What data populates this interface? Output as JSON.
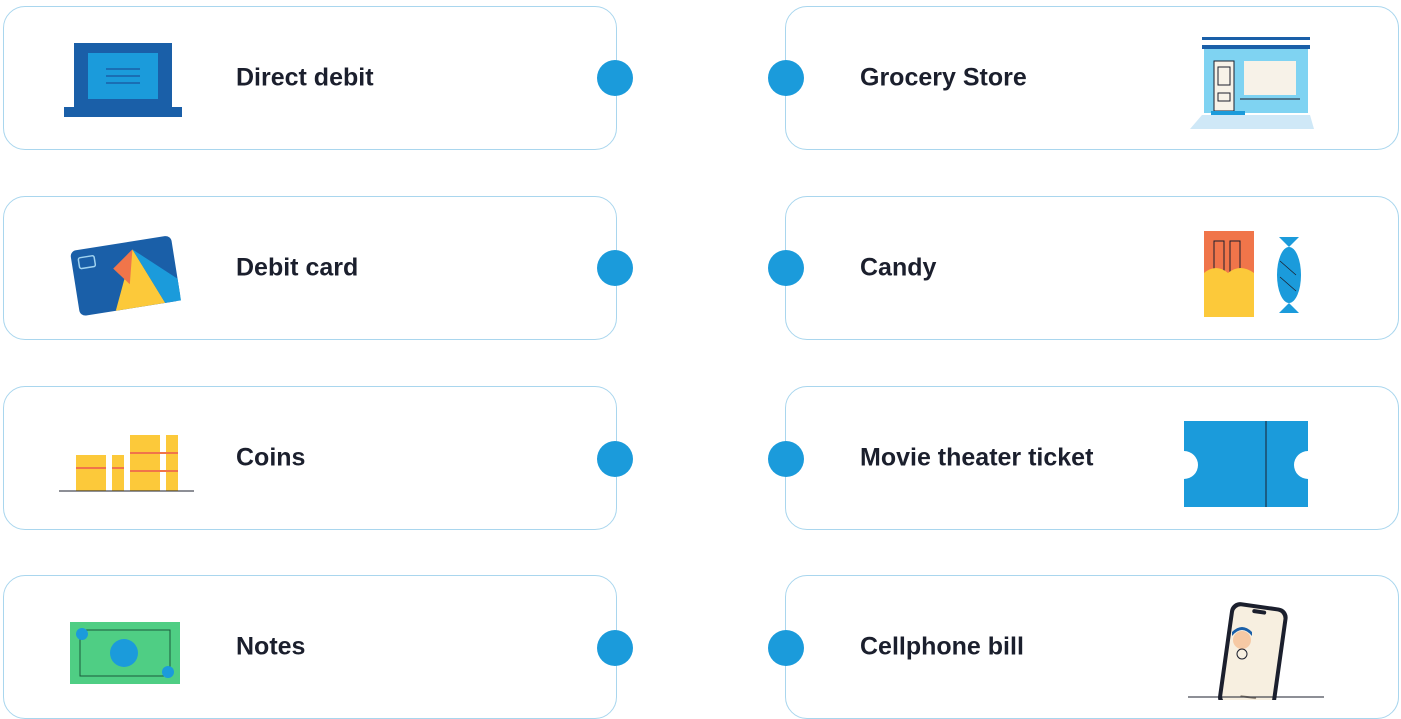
{
  "left_items": [
    {
      "label": "Direct debit",
      "icon": "laptop-icon"
    },
    {
      "label": "Debit card",
      "icon": "debit-card-icon"
    },
    {
      "label": "Coins",
      "icon": "coins-icon"
    },
    {
      "label": "Notes",
      "icon": "banknote-icon"
    }
  ],
  "right_items": [
    {
      "label": "Grocery Store",
      "icon": "store-icon"
    },
    {
      "label": "Candy",
      "icon": "candy-icon"
    },
    {
      "label": "Movie theater ticket",
      "icon": "ticket-icon"
    },
    {
      "label": "Cellphone bill",
      "icon": "phone-icon"
    }
  ],
  "colors": {
    "card_border": "#a9d6ee",
    "connector_dot": "#1b9bdb",
    "text": "#1b1f2d",
    "primary_blue": "#1a5fa8",
    "light_blue": "#1b9bdb",
    "yellow": "#fcc93a",
    "orange": "#f0754a",
    "green": "#4fce84"
  }
}
